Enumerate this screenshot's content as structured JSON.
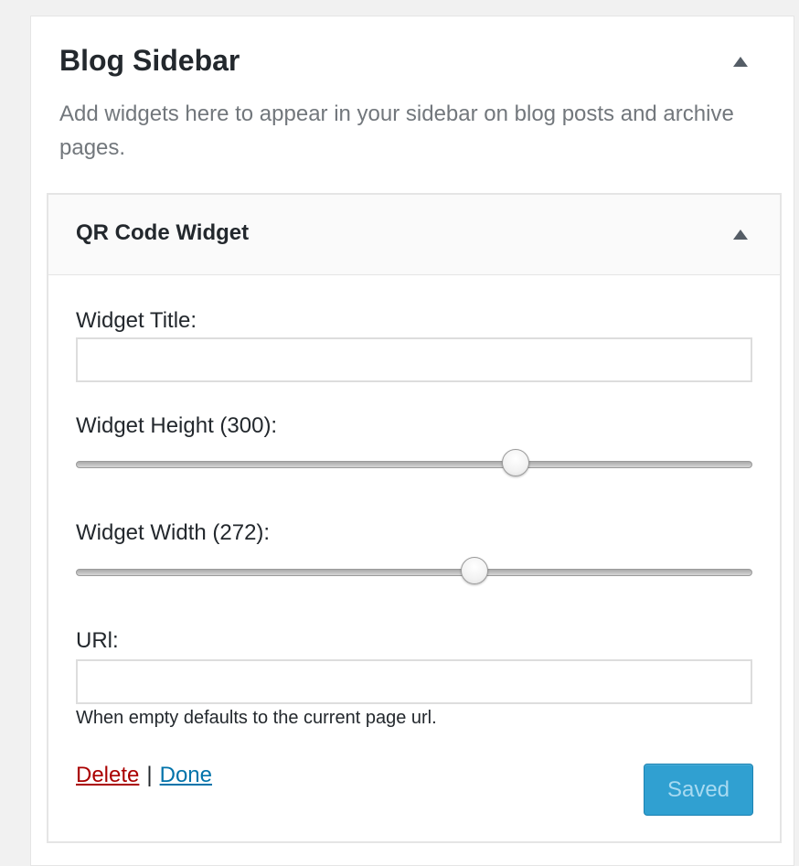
{
  "sidebar": {
    "title": "Blog Sidebar",
    "description": "Add widgets here to appear in your sidebar on blog posts and archive pages."
  },
  "widget": {
    "title": "QR Code Widget",
    "fields": {
      "title_label": "Widget Title:",
      "title_value": "",
      "height_label": "Widget Height (300):",
      "height_slider_fraction": 0.65,
      "width_label": "Widget Width (272):",
      "width_slider_fraction": 0.589,
      "url_label": "URl:",
      "url_value": "",
      "url_help": "When empty defaults to the current page url."
    },
    "actions": {
      "delete_label": "Delete",
      "separator": "|",
      "done_label": "Done",
      "saved_label": "Saved"
    }
  },
  "colors": {
    "delete_link": "#aa0000",
    "done_link": "#0073aa",
    "saved_button_bg": "#30a0d1",
    "saved_button_text": "#a7daf1"
  },
  "icons": {
    "collapse_toggle": "triangle-up-icon"
  }
}
